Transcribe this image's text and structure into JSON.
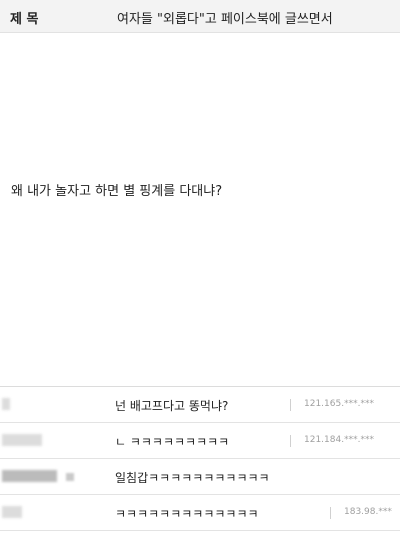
{
  "post": {
    "subject_label": "제 목",
    "subject": "여자들 \"외롭다\"고 페이스북에 글쓰면서",
    "body": "왜 내가 놀자고 하면 별 핑계를 다대냐?"
  },
  "comments": [
    {
      "text": "넌 배고프다고 똥먹냐?",
      "ip": "121.165.***.***"
    },
    {
      "text": "ㄴ ㅋㅋㅋㅋㅋㅋㅋㅋㅋ",
      "ip": "121.184.***.***"
    },
    {
      "text": "일침갑ㅋㅋㅋㅋㅋㅋㅋㅋㅋㅋㅋ",
      "ip": ""
    },
    {
      "text": "ㅋㅋㅋㅋㅋㅋㅋㅋㅋㅋㅋㅋㅋ",
      "ip": "183.98.***"
    }
  ]
}
